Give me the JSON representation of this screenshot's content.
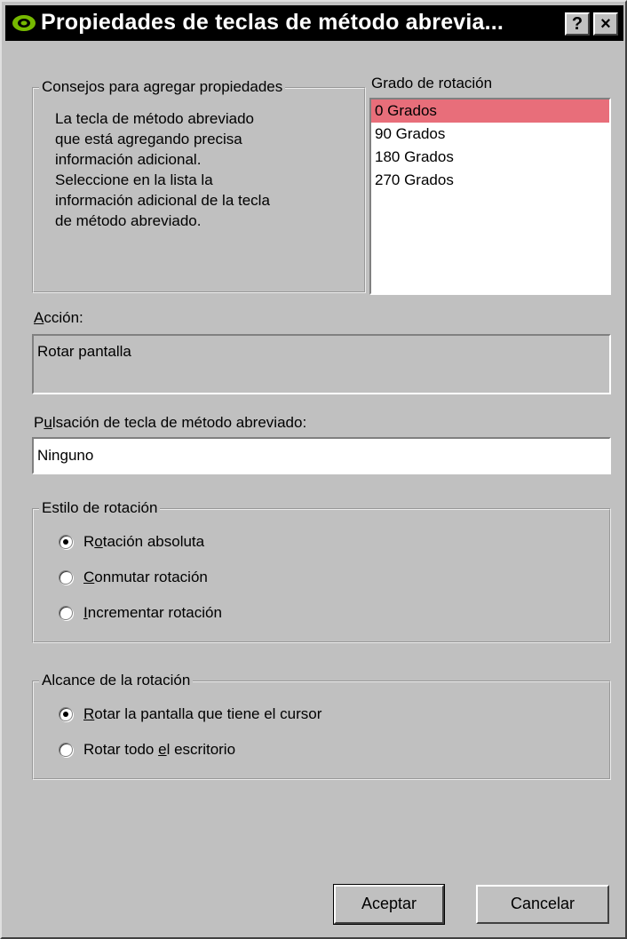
{
  "window": {
    "title": "Propiedades de teclas de método abrevia..."
  },
  "titlebar": {
    "help": "?",
    "close": "×"
  },
  "tips": {
    "legend": "Consejos para agregar propiedades",
    "lines": [
      "La tecla de método abreviado",
      "que está agregando precisa",
      "información adicional.",
      "Seleccione en la lista la",
      "información adicional de la tecla",
      "de método abreviado."
    ]
  },
  "rotation_degree": {
    "label": "Grado de rotación",
    "options": [
      "0 Grados",
      "90 Grados",
      "180 Grados",
      "270 Grados"
    ],
    "selected": "0 Grados"
  },
  "action": {
    "label_u": "A",
    "label_rest": "cción:",
    "value": "Rotar pantalla"
  },
  "hotkey": {
    "label_a": "P",
    "label_u": "u",
    "label_b": "lsación de tecla de método abreviado:",
    "value": "Ninguno"
  },
  "rotation_style": {
    "legend": "Estilo de rotación",
    "options": [
      {
        "a": "R",
        "u": "o",
        "b": "tación absoluta",
        "checked": true
      },
      {
        "a": "",
        "u": "C",
        "b": "onmutar rotación",
        "checked": false
      },
      {
        "a": "",
        "u": "I",
        "b": "ncrementar rotación",
        "checked": false
      }
    ]
  },
  "rotation_scope": {
    "legend": "Alcance de la rotación",
    "options": [
      {
        "a": "",
        "u": "R",
        "b": "otar la pantalla que tiene el cursor",
        "checked": true
      },
      {
        "a": "Rotar todo ",
        "u": "e",
        "b": "l escritorio",
        "checked": false
      }
    ]
  },
  "buttons": {
    "ok": "Aceptar",
    "cancel": "Cancelar"
  }
}
